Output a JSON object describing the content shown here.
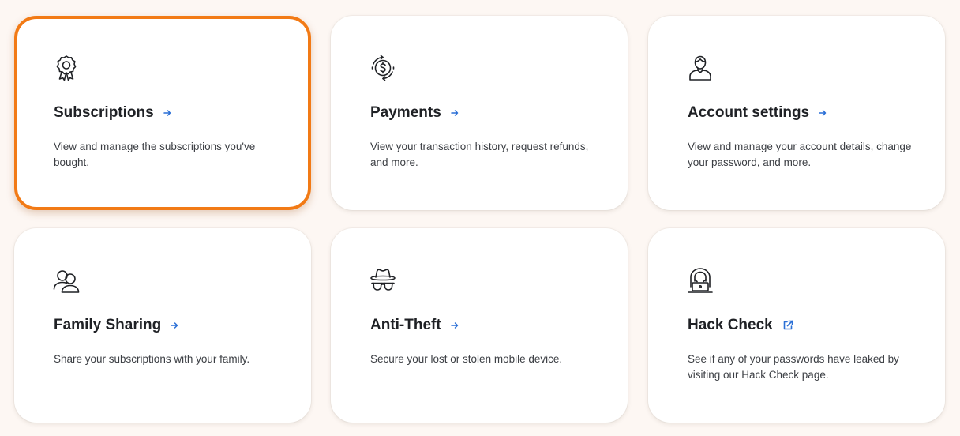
{
  "colors": {
    "background": "#fdf7f3",
    "card": "#ffffff",
    "highlight_border": "#f27a15",
    "link_arrow": "#2a6fd6",
    "title_text": "#1f2125",
    "body_text": "#3c3f44"
  },
  "cards": [
    {
      "icon": "award-badge-icon",
      "title": "Subscriptions",
      "link_icon": "arrow-right-icon",
      "description": "View and manage the subscriptions you've bought.",
      "selected": true
    },
    {
      "icon": "dollar-cycle-icon",
      "title": "Payments",
      "link_icon": "arrow-right-icon",
      "description": "View your transaction history, request refunds, and more.",
      "selected": false
    },
    {
      "icon": "user-icon",
      "title": "Account settings",
      "link_icon": "arrow-right-icon",
      "description": "View and manage your account details, change your password, and more.",
      "selected": false
    },
    {
      "icon": "users-icon",
      "title": "Family Sharing",
      "link_icon": "arrow-right-icon",
      "description": "Share your subscriptions with your family.",
      "selected": false
    },
    {
      "icon": "spy-icon",
      "title": "Anti-Theft",
      "link_icon": "arrow-right-icon",
      "description": "Secure your lost or stolen mobile device.",
      "selected": false
    },
    {
      "icon": "hacker-icon",
      "title": "Hack Check",
      "link_icon": "external-link-icon",
      "description": "See if any of your passwords have leaked by visiting our Hack Check page.",
      "selected": false
    }
  ]
}
